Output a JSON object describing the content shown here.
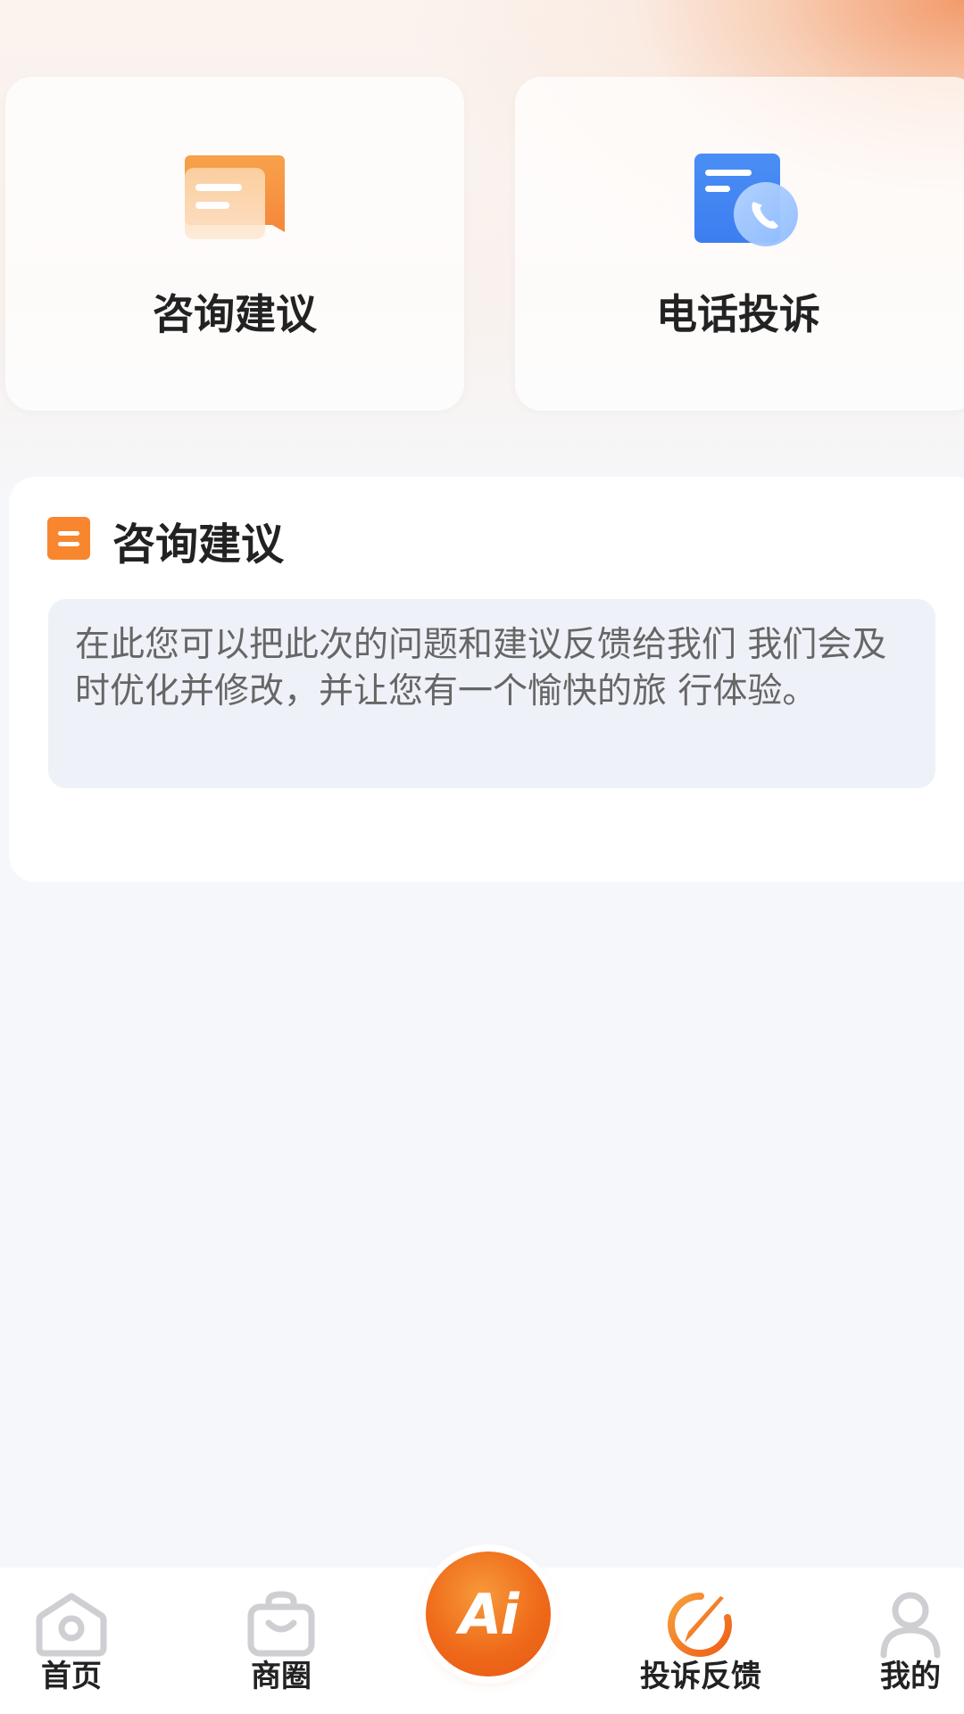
{
  "cards": [
    {
      "label": "咨询建议",
      "icon": "chat-message-icon"
    },
    {
      "label": "电话投诉",
      "icon": "phone-complaint-icon"
    }
  ],
  "panel": {
    "title": "咨询建议",
    "icon": "list-icon",
    "description": "在此您可以把此次的问题和建议反馈给我们 我们会及时优化并修改，并让您有一个愉快的旅 行体验。"
  },
  "tabbar": {
    "home": "首页",
    "circle": "商圈",
    "ai": "Ai",
    "complaint": "投诉反馈",
    "mine": "我的"
  },
  "colors": {
    "accent": "#f07a2a",
    "ai_button": "#ef6a1a",
    "phone_icon": "#3d86f2"
  }
}
